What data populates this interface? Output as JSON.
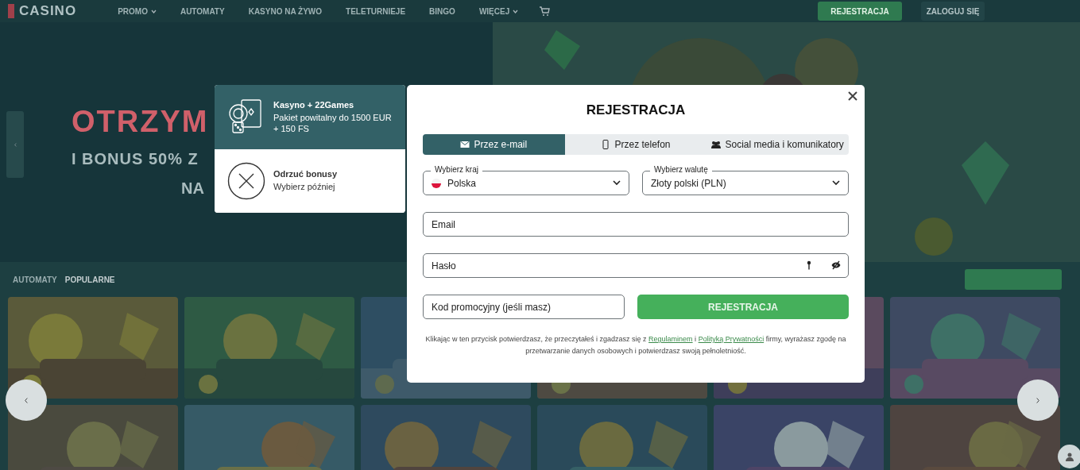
{
  "nav": {
    "logo": "CASINO",
    "items": [
      {
        "label": "PROMO",
        "dropdown": true
      },
      {
        "label": "AUTOMATY",
        "dropdown": false
      },
      {
        "label": "KASYNO NA ŻYWO",
        "dropdown": false
      },
      {
        "label": "TELETURNIEJE",
        "dropdown": false
      },
      {
        "label": "BINGO",
        "dropdown": false
      },
      {
        "label": "WIĘCEJ",
        "dropdown": true
      }
    ],
    "register": "REJESTRACJA",
    "login": "ZALOGUJ SIĘ"
  },
  "hero": {
    "title": "OTRZYM",
    "subtitle": "I BONUS 50% Z",
    "subtitle_2": "NA"
  },
  "section": {
    "tabs": [
      {
        "label": "AUTOMATY",
        "selected": false
      },
      {
        "label": "POPULARNE",
        "selected": true
      }
    ]
  },
  "bonus_options": [
    {
      "kind": "bonus",
      "title": "Kasyno + 22Games",
      "description": "Pakiet powitalny do 1500 EUR + 150 FS",
      "selected": true
    },
    {
      "kind": "decline",
      "title": "Odrzuć bonusy",
      "description": "Wybierz później",
      "selected": false
    }
  ],
  "modal": {
    "title": "REJESTRACJA",
    "tabs": [
      {
        "kind": "email",
        "label": "Przez e-mail",
        "selected": true
      },
      {
        "kind": "phone",
        "label": "Przez telefon",
        "selected": false
      },
      {
        "kind": "social",
        "label": "Social media i komunikatory",
        "selected": false
      }
    ],
    "country": {
      "label": "Wybierz kraj",
      "value": "Polska"
    },
    "currency": {
      "label": "Wybierz walutę",
      "value": "Złoty polski (PLN)"
    },
    "email": {
      "placeholder": "Email"
    },
    "password": {
      "placeholder": "Hasło"
    },
    "promo": {
      "placeholder": "Kod promocyjny (jeśli masz)"
    },
    "submit": "REJESTRACJA",
    "consent": [
      {
        "text": "Klikając w ten przycisk potwierdzasz, że przeczytałeś i zgadzasz się z ",
        "kind": "text"
      },
      {
        "text": "Regulaminem",
        "kind": "link"
      },
      {
        "text": " i ",
        "kind": "text"
      },
      {
        "text": "Polityką Prywatności",
        "kind": "link"
      },
      {
        "text": " firmy, wyrażasz zgodę na przetwarzanie danych osobowych i potwierdzasz swoją pełnoletniość.",
        "kind": "text"
      }
    ]
  }
}
